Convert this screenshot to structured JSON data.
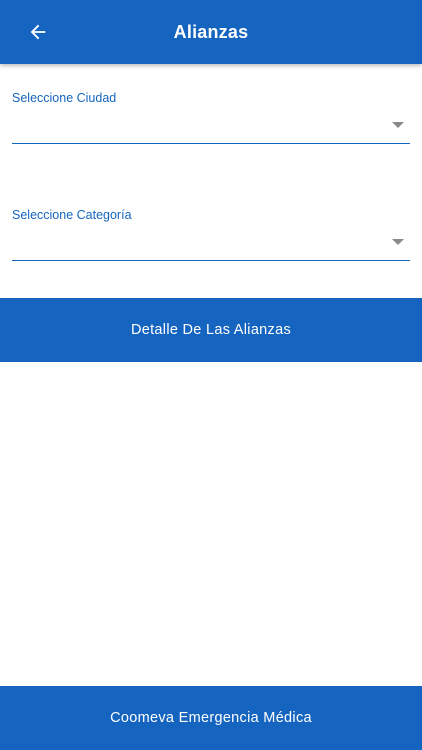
{
  "header": {
    "title": "Alianzas",
    "back_icon": "arrow-back-icon"
  },
  "form": {
    "city": {
      "label": "Seleccione Ciudad",
      "value": ""
    },
    "category": {
      "label": "Seleccione Categoría",
      "value": ""
    }
  },
  "actions": {
    "detail_label": "Detalle De Las Alianzas"
  },
  "footer": {
    "text": "Coomeva Emergencia Médica"
  },
  "colors": {
    "primary": "#1565c0",
    "background": "#ffffff",
    "dropdown_arrow": "#8a8a8a"
  }
}
